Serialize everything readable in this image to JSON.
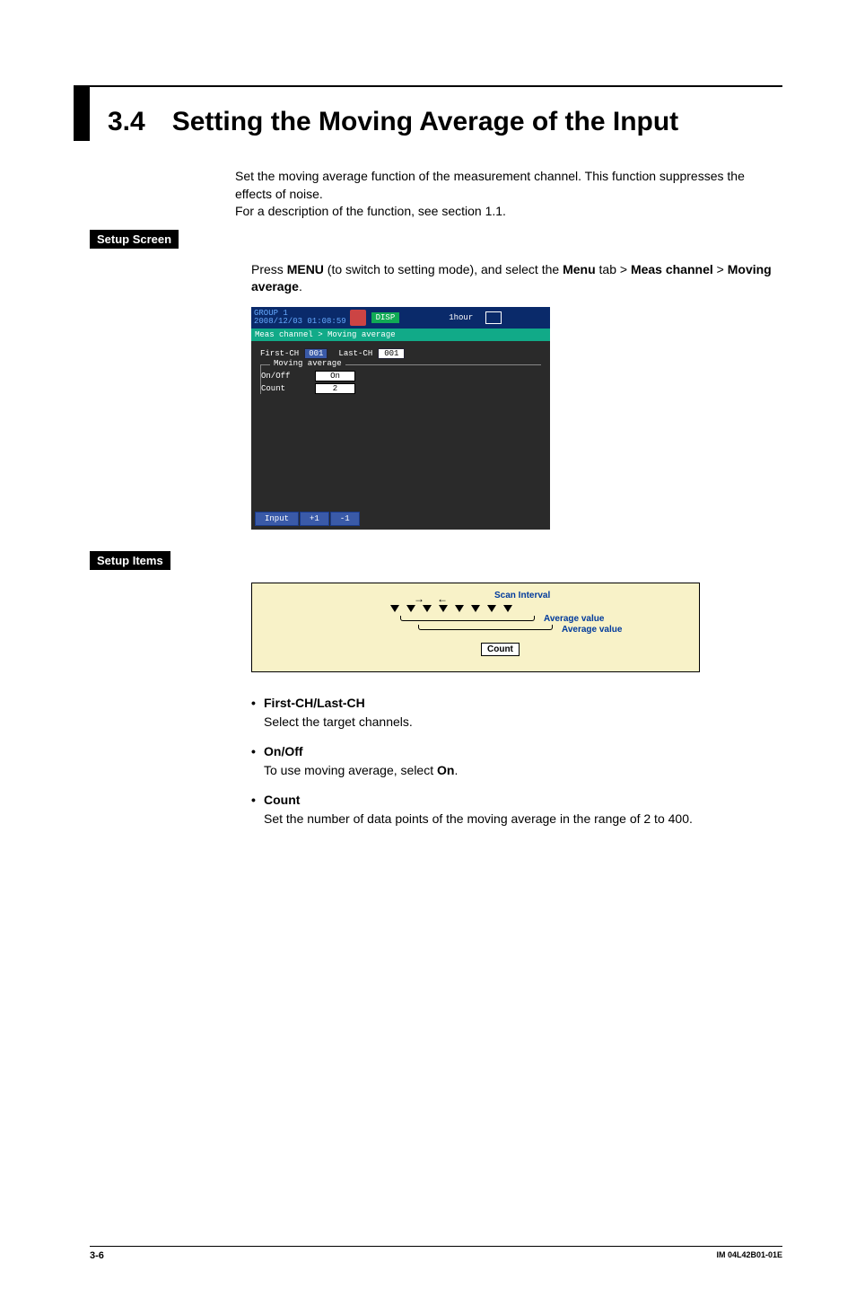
{
  "section": {
    "number": "3.4",
    "title": "Setting the Moving Average of the Input"
  },
  "intro": {
    "p1": "Set the moving average function of the measurement channel. This function suppresses the effects of noise.",
    "p2": "For a description of the function, see section 1.1."
  },
  "labels": {
    "setup_screen": "Setup Screen",
    "setup_items": "Setup Items"
  },
  "setup_screen_text": {
    "line1a": "Press ",
    "menu": "MENU",
    "line1b": " (to switch to setting mode), and select the ",
    "menu_tab": "Menu",
    "line1c": " tab > ",
    "meas": "Meas channel",
    "gt": " > ",
    "moving": "Moving average",
    "period": "."
  },
  "screenshot": {
    "group_line1": "GROUP 1",
    "group_line2": "2008/12/03 01:08:59",
    "disp": "DISP",
    "hour": "1hour",
    "breadcrumb": "Meas channel > Moving average",
    "firstch": "First-CH",
    "firstch_val": "001",
    "lastch": "Last-CH",
    "lastch_val": "001",
    "legend": "Moving average",
    "onoff": "On/Off",
    "onoff_val": "On",
    "count": "Count",
    "count_val": "2",
    "btn_input": "Input",
    "btn_plus": "+1",
    "btn_minus": "-1"
  },
  "diagram": {
    "scan_interval": "Scan Interval",
    "avg1": "Average value",
    "avg2": "Average value",
    "count": "Count"
  },
  "items": {
    "h1": "First-CH/Last-CH",
    "t1": "Select the target channels.",
    "h2": "On/Off",
    "t2a": "To use moving average, select ",
    "t2b": "On",
    "t2c": ".",
    "h3": "Count",
    "t3": "Set the number of data points of the moving average in the range of 2 to 400."
  },
  "footer": {
    "left": "3-6",
    "right": "IM 04L42B01-01E"
  }
}
